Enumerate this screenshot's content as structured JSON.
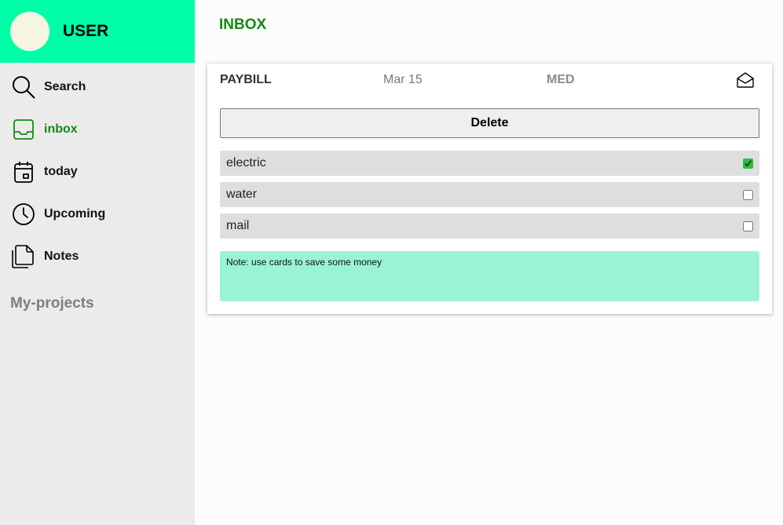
{
  "user": {
    "name": "USER"
  },
  "nav": {
    "items": [
      {
        "id": "search",
        "label": "Search",
        "icon": "search-icon",
        "active": false
      },
      {
        "id": "inbox",
        "label": "inbox",
        "icon": "inbox-tray-icon",
        "active": true
      },
      {
        "id": "today",
        "label": "today",
        "icon": "calendar-icon",
        "active": false
      },
      {
        "id": "upcoming",
        "label": "Upcoming",
        "icon": "clock-icon",
        "active": false
      },
      {
        "id": "notes",
        "label": "Notes",
        "icon": "notes-stack-icon",
        "active": false
      }
    ],
    "projects_title": "My-projects"
  },
  "page": {
    "title": "INBOX"
  },
  "task": {
    "title": "PAYBILL",
    "date": "Mar 15",
    "priority": "MED",
    "mail_icon": "envelope-open-icon",
    "delete_label": "Delete",
    "checklist": [
      {
        "label": "electric",
        "checked": true
      },
      {
        "label": "water",
        "checked": false
      },
      {
        "label": "mail",
        "checked": false
      }
    ],
    "note": "Note: use cards to save some money"
  },
  "colors": {
    "header_accent": "#00fea8",
    "active_green": "#138a16",
    "note_bg": "#99f4d5",
    "sidebar_bg": "#ebebeb"
  }
}
